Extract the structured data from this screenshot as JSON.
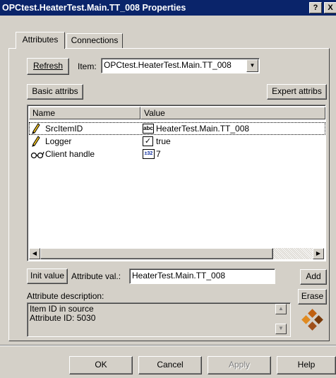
{
  "window": {
    "title": "OPCtest.HeaterTest.Main.TT_008 Properties",
    "help_glyph": "?",
    "close_glyph": "X"
  },
  "tabs": [
    {
      "label": "Attributes",
      "active": true
    },
    {
      "label": "Connections",
      "active": false
    }
  ],
  "toolbar": {
    "refresh_label": "Refresh",
    "item_label": "Item:",
    "item_value": "OPCtest.HeaterTest.Main.TT_008",
    "basic_attribs_label": "Basic attribs",
    "expert_attribs_label": "Expert attribs"
  },
  "list": {
    "columns": [
      "Name",
      "Value"
    ],
    "rows": [
      {
        "name": "SrcItemID",
        "value": "HeaterTest.Main.TT_008",
        "name_icon": "pencil-icon",
        "value_icon": "string-type-icon",
        "value_icon_text": "abc",
        "selected": true
      },
      {
        "name": "Logger",
        "value": "true",
        "name_icon": "pencil-icon",
        "value_icon": "checkbox-icon",
        "value_icon_text": "✓",
        "selected": false
      },
      {
        "name": "Client handle",
        "value": "7",
        "name_icon": "glasses-icon",
        "value_icon": "integer-type-icon",
        "value_icon_text": "±32",
        "selected": false
      }
    ]
  },
  "attribute": {
    "init_value_label": "Init value",
    "attribute_val_label": "Attribute val.:",
    "attribute_val_value": "HeaterTest.Main.TT_008",
    "add_label": "Add",
    "erase_label": "Erase",
    "description_label": "Attribute description:",
    "description_lines": [
      "Item ID in source",
      "Attribute ID: 5030"
    ]
  },
  "footer": {
    "ok_label": "OK",
    "cancel_label": "Cancel",
    "apply_label": "Apply",
    "help_label": "Help"
  },
  "colors": {
    "titlebar": "#0a246a",
    "face": "#d4d0c8",
    "selection_dots": "#000000",
    "disabled_text": "#808080"
  }
}
